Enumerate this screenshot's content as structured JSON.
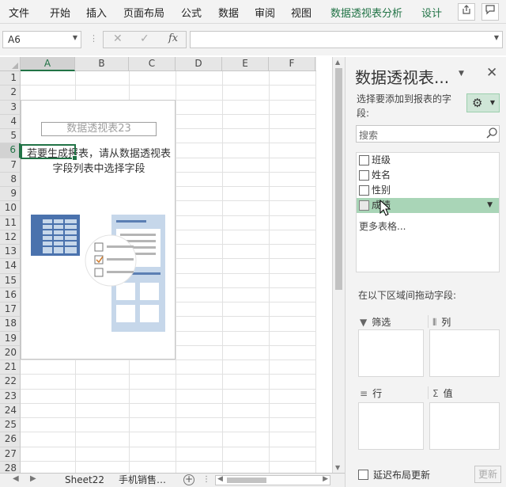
{
  "ribbon": {
    "tabs": [
      "文件",
      "开始",
      "插入",
      "页面布局",
      "公式",
      "数据",
      "审阅",
      "视图",
      "数据透视表分析",
      "设计"
    ],
    "share_icon": "share-icon",
    "comment_icon": "comment-icon"
  },
  "formula_bar": {
    "name_box": "A6",
    "fx": "fx",
    "formula": ""
  },
  "grid": {
    "columns": [
      "A",
      "B",
      "C",
      "D",
      "E",
      "F"
    ],
    "rows": [
      "1",
      "2",
      "3",
      "4",
      "5",
      "6",
      "7",
      "8",
      "9",
      "10",
      "11",
      "12",
      "13",
      "14",
      "15",
      "16",
      "17",
      "18",
      "19",
      "20",
      "21",
      "22",
      "23",
      "24",
      "25",
      "26",
      "27",
      "28"
    ],
    "selected_cell": "A6"
  },
  "pivot_placeholder": {
    "title": "数据透视表23",
    "message": "若要生成报表，请从数据透视表字段列表中选择字段"
  },
  "sheet_tabs": {
    "tabs": [
      "Sheet22",
      "手机销售…"
    ],
    "add": "+"
  },
  "pane": {
    "title": "数据透视表...",
    "subtitle": "选择要添加到报表的字段:",
    "search_placeholder": "搜索",
    "fields": [
      {
        "label": "班级",
        "checked": false
      },
      {
        "label": "姓名",
        "checked": false
      },
      {
        "label": "性别",
        "checked": false
      },
      {
        "label": "成绩",
        "checked": false,
        "highlighted": true
      }
    ],
    "more_tables": "更多表格...",
    "drag_label": "在以下区域间拖动字段:",
    "zones": {
      "filter": "筛选",
      "columns": "列",
      "rows": "行",
      "values": "值"
    },
    "defer_label": "延迟布局更新",
    "update_button": "更新"
  },
  "colors": {
    "accent": "#217346",
    "highlight": "#a9d5b7",
    "pane_bg": "#f3f3f3"
  }
}
